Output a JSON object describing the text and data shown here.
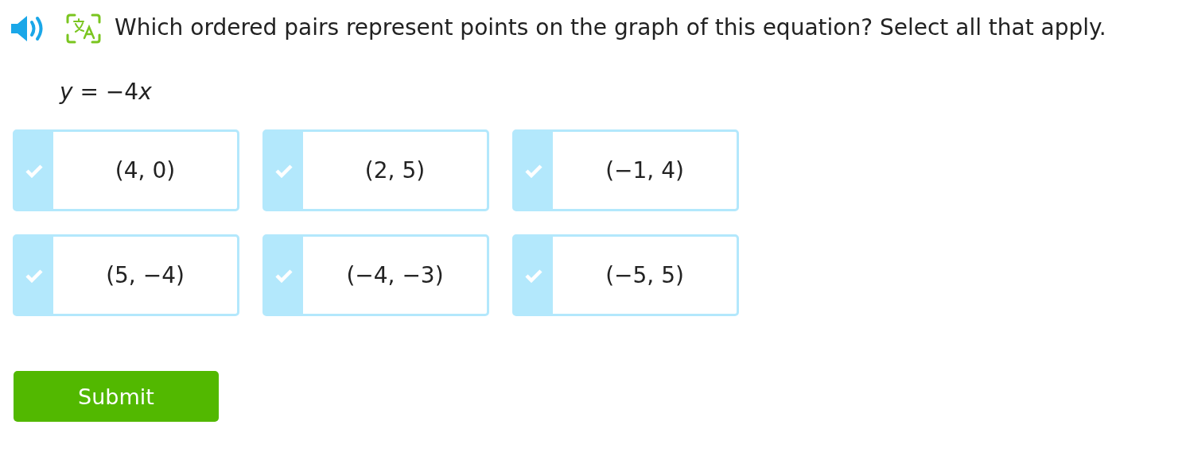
{
  "question": {
    "text": "Which ordered pairs represent points on the graph of this equation? Select all that apply."
  },
  "equation": [
    {
      "kind": "var",
      "text": "y"
    },
    {
      "kind": "plain",
      "text": " = −4"
    },
    {
      "kind": "var",
      "text": "x"
    }
  ],
  "options": [
    {
      "label": "(4, 0)",
      "selected": false
    },
    {
      "label": "(2, 5)",
      "selected": false
    },
    {
      "label": "(−1, 4)",
      "selected": false
    },
    {
      "label": "(5, −4)",
      "selected": false
    },
    {
      "label": "(−4, −3)",
      "selected": false
    },
    {
      "label": "(−5, 5)",
      "selected": false
    }
  ],
  "submit": {
    "label": "Submit"
  }
}
